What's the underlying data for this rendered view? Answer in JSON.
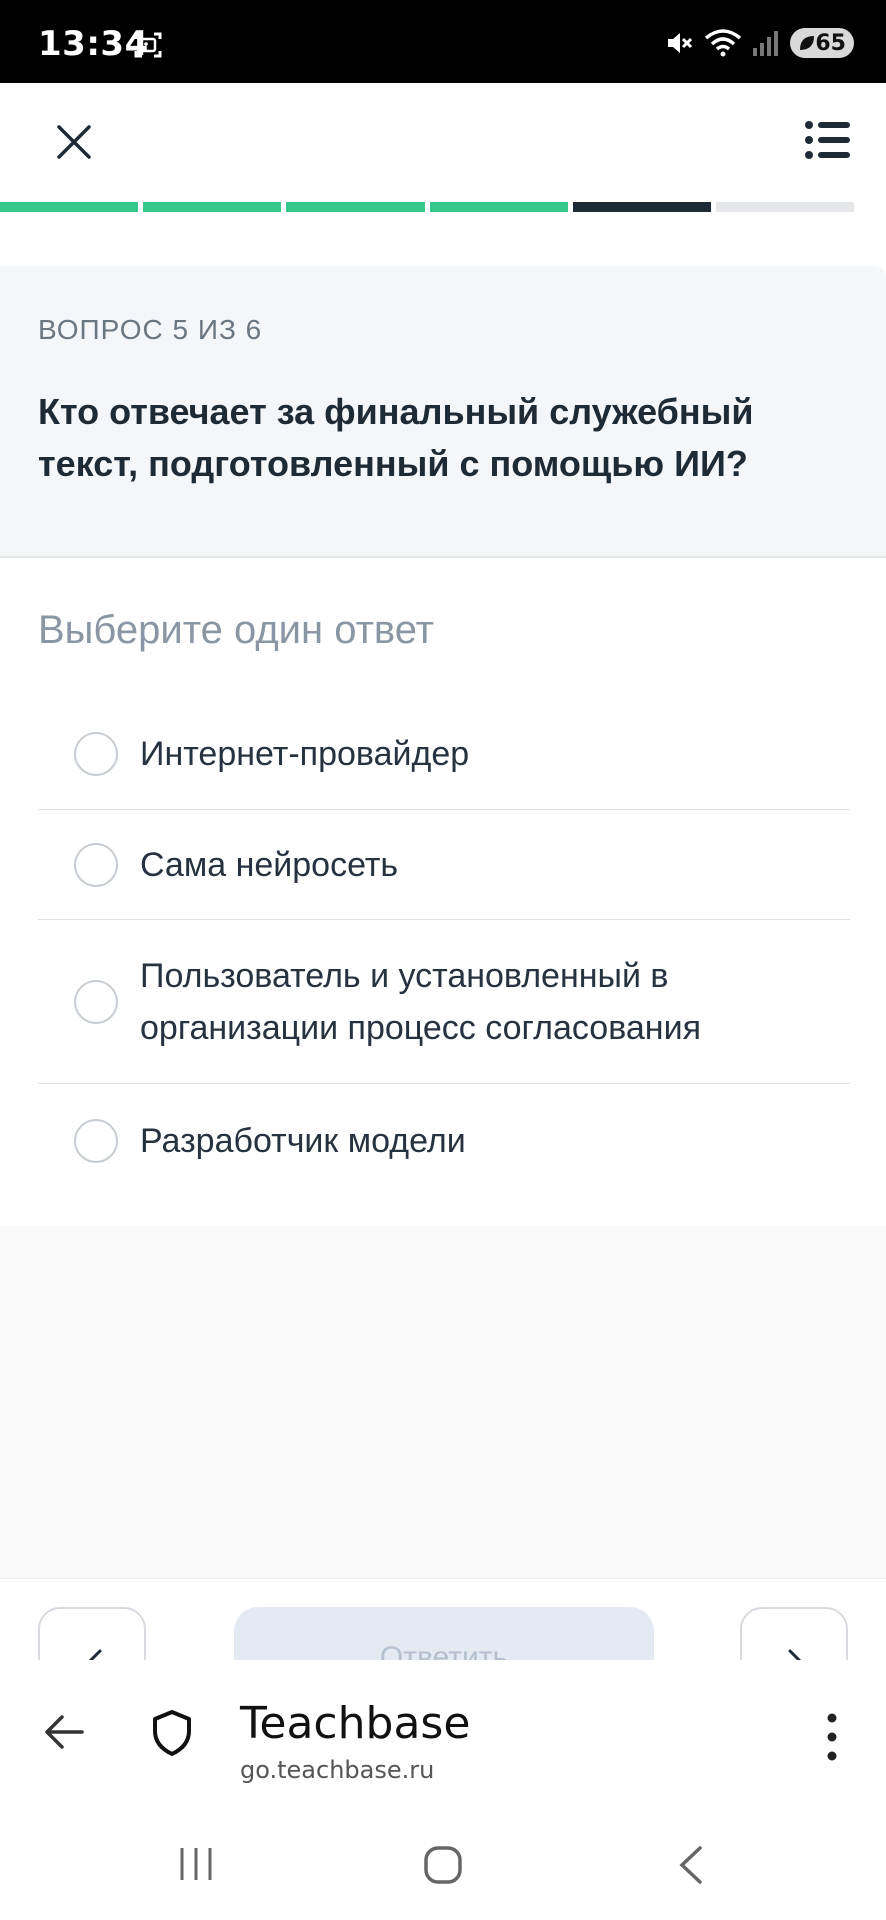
{
  "status_bar": {
    "time": "13:34",
    "battery": "65"
  },
  "header": {
    "close_icon": "close-icon",
    "menu_icon": "list-menu-icon"
  },
  "progress": {
    "total": 6,
    "current": 5,
    "colors": {
      "done": "#34c98a",
      "current": "#1f2a37",
      "todo": "#e5e7eb"
    }
  },
  "question": {
    "counter": "ВОПРОС 5 ИЗ 6",
    "text": "Кто отвечает за финальный служебный текст, подготовленный с помощью ИИ?"
  },
  "answers": {
    "label": "Выберите один ответ",
    "options": [
      {
        "text": "Интернет-провайдер",
        "selected": false
      },
      {
        "text": "Сама нейросеть",
        "selected": false
      },
      {
        "text": "Пользователь и установленный в организации процесс согласования",
        "selected": false
      },
      {
        "text": "Разработчик модели",
        "selected": false
      }
    ]
  },
  "actions": {
    "answer_label": "Ответить"
  },
  "browser": {
    "site_title": "Teachbase",
    "site_url": "go.teachbase.ru"
  }
}
